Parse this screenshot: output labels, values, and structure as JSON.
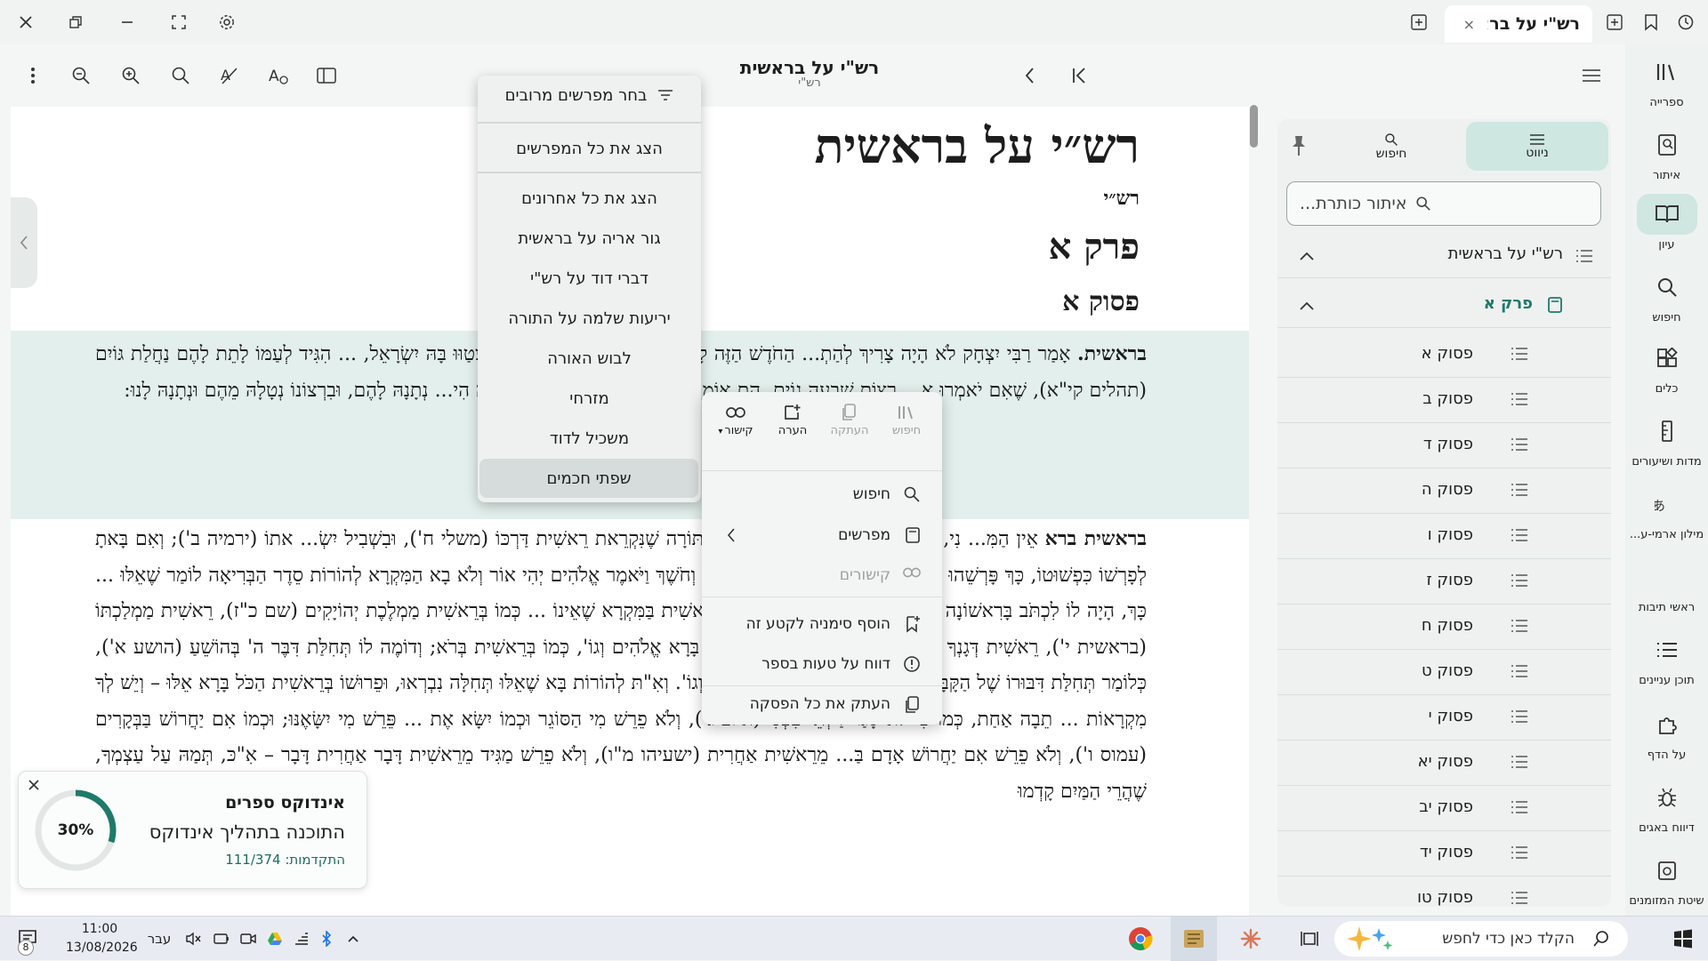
{
  "window": {
    "tab_title": "רש\"י על בראשית",
    "tab_close": "×"
  },
  "reader_header": {
    "title": "רש\"י על בראשית",
    "subtitle": "רש\"י"
  },
  "rail": [
    {
      "label": "ספרייה",
      "icon": "library-icon"
    },
    {
      "label": "איתור",
      "icon": "find-book-icon"
    },
    {
      "label": "עיון",
      "icon": "book-open-icon",
      "active": true
    },
    {
      "label": "חיפוש",
      "icon": "search-icon"
    },
    {
      "label": "כלים",
      "icon": "tools-icon"
    },
    {
      "label": "מדות ושיעורים",
      "icon": "ruler-icon"
    },
    {
      "label": "מילון ארמי-ע...",
      "icon": "dictionary-icon"
    },
    {
      "label": "ראשי תיבות",
      "icon": "quote-icon"
    },
    {
      "label": "תוכן עניינים",
      "icon": "list-icon"
    },
    {
      "label": "על הדף",
      "icon": "puzzle-icon"
    },
    {
      "label": "דיווח באגים",
      "icon": "bug-icon"
    },
    {
      "label": "שיטת המזומנים",
      "icon": "calendar-icon"
    }
  ],
  "sidebar": {
    "tabs": [
      {
        "label": "ניווט",
        "icon": "menu-icon",
        "active": true
      },
      {
        "label": "חיפוש",
        "icon": "search-icon"
      }
    ],
    "search_placeholder": "איתור כותרת...",
    "book_title": "רש\"י על בראשית",
    "chapter": "פרק א",
    "verses": [
      "פסוק א",
      "פסוק ב",
      "פסוק ד",
      "פסוק ה",
      "פסוק ו",
      "פסוק ז",
      "פסוק ח",
      "פסוק ט",
      "פסוק י",
      "פסוק יא",
      "פסוק יב",
      "פסוק יד",
      "פסוק טו"
    ]
  },
  "content": {
    "book_title": "רש״י על בראשית",
    "author": "רש״י",
    "chapter": "פרק א",
    "verse": "פסוק א",
    "para1_bold": "בראשית.",
    "para1_text": " אָמַר רַבִּי יִצְחָק לֹא הָיָה צָרִיךְ לְהַתְ... הַחֹדֶשׁ הַזֶּה לָכֶם, שֶׁהִיא מִצְוָה רִאשׁוֹנָה שֶׁנִּצְטַוּוּ בָּהּ יִשְׂרָאֵל, ... הִגִּיד לְעַמּוֹ לָתֵת לָהֶם נַחֲלַת גּוֹיִם (תהלים קי\"א), שֶׁאִם יֹאמְרוּ א... רְצוֹת שִׁבְעָה גוֹיִם, הֵם אוֹמְרִים לָהֶם כָּל הָאָרֶץ שֶׁל הַקָּבָּ\"ה הִי... נְתָנָהּ לָהֶם, וּבִרְצוֹנוֹ נְטָלָהּ מֵהֶם וּנְתָנָהּ לָנוּ:",
    "para2_bold": "בראשית ברא",
    "para2_text": " אֵין הַמִּ... נִי, כְּמוֹ שֶׁדְּרָשׁוּהוּ רַבּוֹתֵינוּ בִּשְׁבִיל הַתּוֹרָה שֶׁנִּקְרֵאת רֵאשִׁית דַּרְכּוֹ (משלי ח'), וּבִשְׁבִיל יִשְׂ... אתוֹ (ירמיה ב'); וְאִם בָּאתָ לְפָרְשׁוֹ כִּפְשׁוּטוֹ, כָּךְ פָּרְשֵׁהוּ בְּרֵאשִׁית בְּרִיאַת שָׁמַיִם וָאָרֶץ, ... וְחֹשֶׁךְ וַיֹּאמֶר אֱלֹהִים יְהִי אוֹר וְלֹא בָא הַמִּקְרָא לְהוֹרוֹת סֵדֶר הַבְּרִיאָה לוֹמַר שֶׁאֵלּוּ ... כָּךְ, הָיָה לוֹ לִכְתֹּב בָּרִאשׁוֹנָה בָּרָא אֶת הַשָּׁמַיִם וְגוֹ' שֶׁאֵין לְךָ רֵאשִׁית בַּמִּקְרָא שֶׁאֵינוֹ ... כְּמוֹ בְּרֵאשִׁית מַמְלֶכֶת יְהוֹיָקִים (שם כ\"ז), רֵאשִׁית מַמְלַכְתּוֹ (בראשית י'), רֵאשִׁית דְּגָנְךָ (דברים ...), ... אוֹמֵר בְּרֵאשִׁית בָּרָא אֱלֹהִים וְגוֹ', כְּמוֹ בְּרֵאשִׁית בְּרֹא; וְדוֹמֶה לוֹ תְּחִלַּת דִּבֶּר ה' בְּהוֹשֵׁעַ (הושע א'), כְּלוֹמַר תְּחִלַּת דִּבּוּרוֹ שֶׁל הַקָּבָּ\"ה בְּהוֹשֵׁעַ, וַיֹּאמֶר ה' אֶל הוֹשֵׁעַ וְגוֹ'. וְאִ\"תּ לְהוֹרוֹת בָּא שֶׁאֵלּוּ תְּחִלָּה נִבְרְאוּ, וּפֵרוּשׁוֹ בְּרֵאשִׁית הַכֹּל בָּרָא אֵלּוּ – וְיֵשׁ לְךָ מִקְרָאוֹת ... תֵבָה אַחַת, כְּמוֹ כִּי לֹא סָגַר דַּלְתֵי בִטְנִי (איוב ג'), וְלֹא פֵרֵשׁ מִי הַסּוֹגֵר וּכְמוֹ יִשָּׂא אֶת ... פֵּרֵשׁ מִי יִשָּׂאֶנּוּ; וּכְמוֹ אִם יַחֲרוֹשׁ בַּבְּקָרִים (עמוס ו'), וְלֹא פֵרֵשׁ אִם יַחֲרוֹשׁ אָדָם בַּ... מֵרֵאשִׁית אַחֲרִית (ישעיהו מ\"ו), וְלֹא פֵרֵשׁ מַגִּיד מֵרֵאשִׁית דָּבָר אַחֲרִית דָּבָר – אִ\"כּ, תְּמַהּ עַל עַצְמְךָ, שֶׁהֲרֵי הַמַּיִם קָדְמוּ"
  },
  "commentators_menu": {
    "header": "בחר מפרשים מרובים",
    "items": [
      "הצג את כל המפרשים",
      "הצג את כל אחרונים",
      "גור אריה על בראשית",
      "דברי דוד על רש\"י",
      "יריעות שלמה על התורה",
      "לבוש האורה",
      "מזרחי",
      "משכיל לדוד",
      "שפתי חכמים"
    ]
  },
  "context_menu": {
    "quick_actions": [
      {
        "label": "חיפוש",
        "disabled": true
      },
      {
        "label": "העתקה",
        "disabled": true
      },
      {
        "label": "הערה",
        "disabled": false
      },
      {
        "label": "קישור",
        "disabled": false
      }
    ],
    "items": [
      {
        "label": "חיפוש"
      },
      {
        "label": "מפרשים"
      },
      {
        "label": "קישורים",
        "disabled": true
      },
      {
        "label": "הוסף סימניה לקטע זה"
      },
      {
        "label": "דווח על טעות בספר"
      },
      {
        "label": "העתק את כל הפסקה"
      }
    ]
  },
  "toast": {
    "title": "אינדוקס ספרים",
    "message": "התוכנה בתהליך אינדוקס",
    "progress_text": "התקדמות: 111/374",
    "percent_label": "30%",
    "progress_fraction": 0.3
  },
  "taskbar": {
    "search_placeholder": "הקלד כאן כדי לחפש",
    "time": "11:00",
    "date": "13/08/2026",
    "language": "עבר",
    "notification_count": "8"
  },
  "colors": {
    "accent": "#1e7a6a",
    "highlight": "#e3efec",
    "rail_active": "#cfe6e1"
  }
}
